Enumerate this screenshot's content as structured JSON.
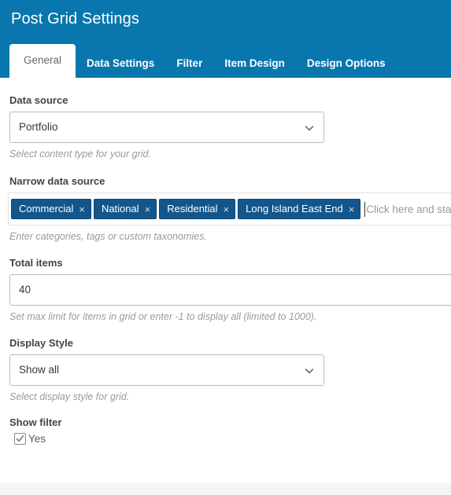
{
  "header": {
    "title": "Post Grid Settings",
    "accent_color": "#0a76ae",
    "tabs": [
      {
        "label": "General",
        "active": true
      },
      {
        "label": "Data Settings",
        "active": false
      },
      {
        "label": "Filter",
        "active": false
      },
      {
        "label": "Item Design",
        "active": false
      },
      {
        "label": "Design Options",
        "active": false
      }
    ]
  },
  "form": {
    "data_source": {
      "label": "Data source",
      "value": "Portfolio",
      "hint": "Select content type for your grid.",
      "icon": "chevron-down-icon"
    },
    "narrow_data_source": {
      "label": "Narrow data source",
      "hint": "Enter categories, tags or custom taxonomies.",
      "placeholder": "Click here and sta",
      "tags": [
        {
          "label": "Commercial",
          "remove": "×"
        },
        {
          "label": "National",
          "remove": "×"
        },
        {
          "label": "Residential",
          "remove": "×"
        },
        {
          "label": "Long Island East End",
          "remove": "×"
        }
      ],
      "tag_color": "#12568c"
    },
    "total_items": {
      "label": "Total items",
      "value": "40",
      "hint": "Set max limit for items in grid or enter -1 to display all (limited to 1000)."
    },
    "display_style": {
      "label": "Display Style",
      "value": "Show all",
      "hint": "Select display style for grid.",
      "icon": "chevron-down-icon"
    },
    "show_filter": {
      "label": "Show filter",
      "checkbox_label": "Yes",
      "checked": true
    }
  }
}
